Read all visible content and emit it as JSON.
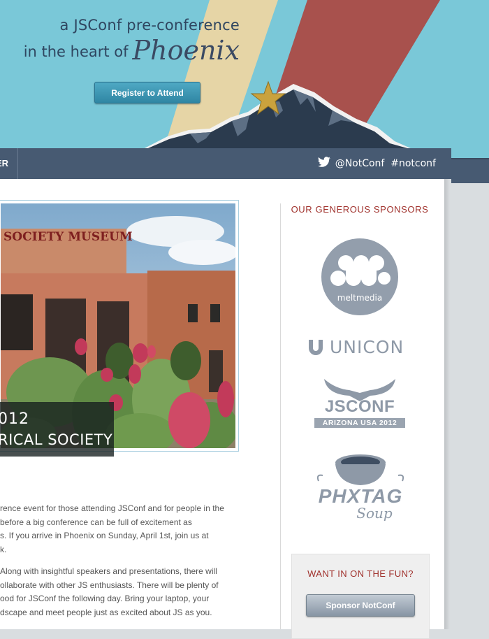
{
  "hero": {
    "tagline_line1": "a JSConf pre-conference",
    "tagline_line2": "in the heart of",
    "city": "Phoenix",
    "register_label": "Register to Attend"
  },
  "nav": {
    "item_partial": "ER",
    "twitter_handle": "@NotConf",
    "hashtag": "#notconf"
  },
  "photo": {
    "sign_text": "SOCIETY MUSEUM",
    "caption_line1": "012",
    "caption_line2": "RICAL SOCIETY"
  },
  "body": {
    "paragraphs": [
      "rence event for those attending JSConf and for people in the\nbefore a big conference can be full of excitement as\ns. If you arrive in Phoenix on Sunday, April 1st, join us at\nk.",
      "Along with insightful speakers and presentations, there will\nollaborate with other JS enthusiasts. There will be plenty of\nood for JSConf the following day. Bring your laptop, your\ndscape and meet people just as excited about JS as you."
    ]
  },
  "sidebar": {
    "sponsors_heading": "OUR GENEROUS SPONSORS",
    "sponsors": [
      {
        "name": "meltmedia"
      },
      {
        "name": "UNICON"
      },
      {
        "name": "JSCONF",
        "sub": "ARIZONA USA 2012"
      },
      {
        "name": "PHXTAG",
        "sub": "Soup"
      }
    ],
    "fun_heading": "WANT IN ON THE FUN?",
    "sponsor_button": "Sponsor NotConf"
  },
  "colors": {
    "sky": "#7ac8d8",
    "nav": "#475a72",
    "accent_red": "#a0312c",
    "register_button": "#3a97b4"
  }
}
